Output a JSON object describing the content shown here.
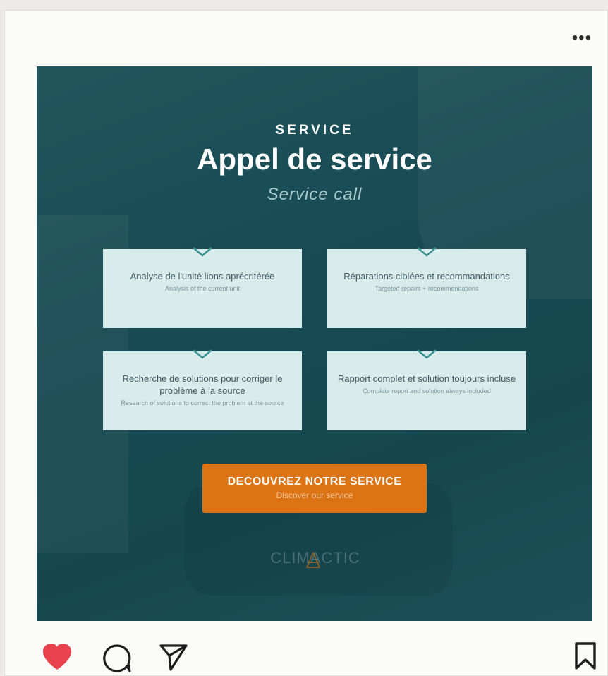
{
  "post": {
    "kicker": "SERVICE",
    "title": "Appel de service",
    "subtitle": "Service call",
    "features": [
      {
        "main": "Analyse de l'unité lions aprécritérée",
        "sub": "Analysis of the current unit"
      },
      {
        "main": "Réparations ciblées et recommandations",
        "sub": "Targeted repairs + recommendations"
      },
      {
        "main": "Recherche de solutions pour corriger le problème à la source",
        "sub": "Research of solutions to correct the problem at the source"
      },
      {
        "main": "Rapport complet et solution toujours incluse",
        "sub": "Complete report and solution always included"
      }
    ],
    "cta_main": "DECOUVREZ NOTRE SERVICE",
    "cta_sub": "Discover our service",
    "logo_text": "CLIMACTIC"
  },
  "colors": {
    "accent": "#dc7314",
    "panel": "#174a53",
    "card": "#d9ecec",
    "like": "#e8424f"
  },
  "icons": [
    "more-icon",
    "heart-icon",
    "comment-icon",
    "share-icon",
    "bookmark-icon",
    "checkmark-icon"
  ]
}
